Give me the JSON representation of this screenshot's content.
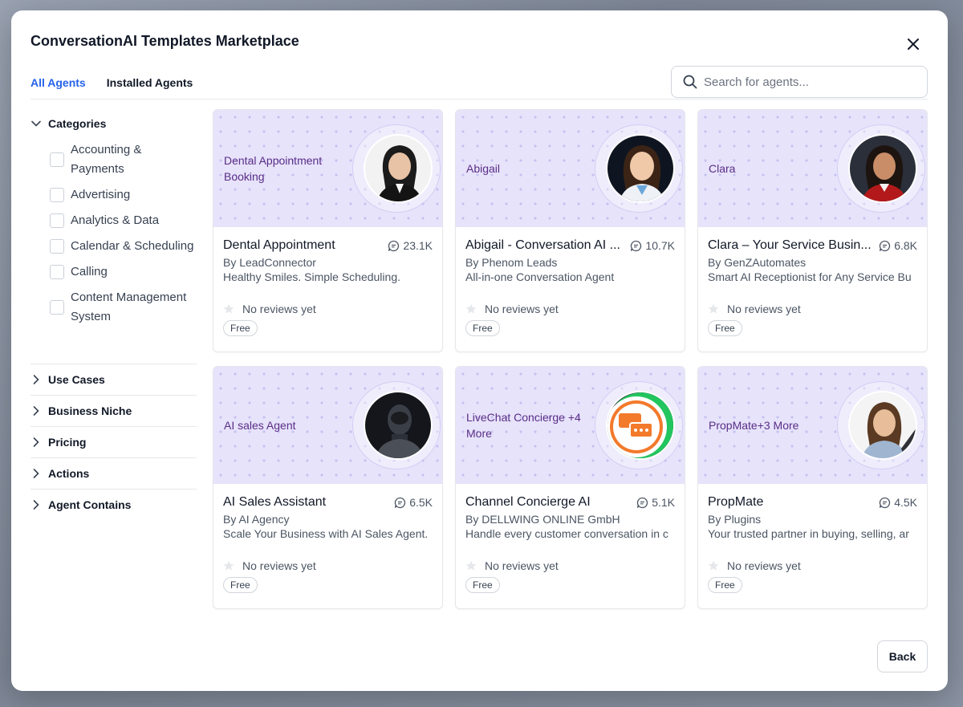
{
  "modal": {
    "title": "ConversationAI Templates Marketplace"
  },
  "tabs": [
    {
      "label": "All Agents",
      "active": true
    },
    {
      "label": "Installed Agents",
      "active": false
    }
  ],
  "search": {
    "placeholder": "Search for agents..."
  },
  "sidebar": {
    "categories_label": "Categories",
    "categories": [
      "Accounting & Payments",
      "Advertising",
      "Analytics & Data",
      "Calendar & Scheduling",
      "Calling",
      "Content Management System"
    ],
    "sections": [
      "Use Cases",
      "Business Niche",
      "Pricing",
      "Actions",
      "Agent Contains"
    ]
  },
  "cards": [
    {
      "banner_label": "Dental Appointment Booking",
      "name": "Dental Appointment",
      "count": "23.1K",
      "author": "By LeadConnector",
      "description": "Healthy Smiles. Simple Scheduling.",
      "reviews": "No reviews yet",
      "price": "Free"
    },
    {
      "banner_label": "Abigail",
      "name": "Abigail - Conversation AI ...",
      "count": "10.7K",
      "author": "By Phenom Leads",
      "description": "All-in-one Conversation Agent",
      "reviews": "No reviews yet",
      "price": "Free"
    },
    {
      "banner_label": "Clara",
      "name": "Clara – Your Service Busin...",
      "count": "6.8K",
      "author": "By GenZAutomates",
      "description": "Smart AI Receptionist for Any Service Bu",
      "reviews": "No reviews yet",
      "price": "Free"
    },
    {
      "banner_label": "AI sales Agent",
      "name": "AI Sales Assistant",
      "count": "6.5K",
      "author": "By AI Agency",
      "description": "Scale Your Business with AI Sales Agent.",
      "reviews": "No reviews yet",
      "price": "Free"
    },
    {
      "banner_label": "LiveChat Concierge +4 More",
      "name": "Channel Concierge AI",
      "count": "5.1K",
      "author": "By DELLWING ONLINE GmbH",
      "description": "Handle every customer conversation in c",
      "reviews": "No reviews yet",
      "price": "Free"
    },
    {
      "banner_label": "PropMate+3 More",
      "name": "PropMate",
      "count": "4.5K",
      "author": "By Plugins",
      "description": "Your trusted partner in buying, selling, ar",
      "reviews": "No reviews yet",
      "price": "Free"
    }
  ],
  "footer": {
    "back_label": "Back"
  },
  "colors": {
    "accent": "#2563eb",
    "banner_bg": "#e6e3fb",
    "banner_text": "#5b2d86"
  }
}
